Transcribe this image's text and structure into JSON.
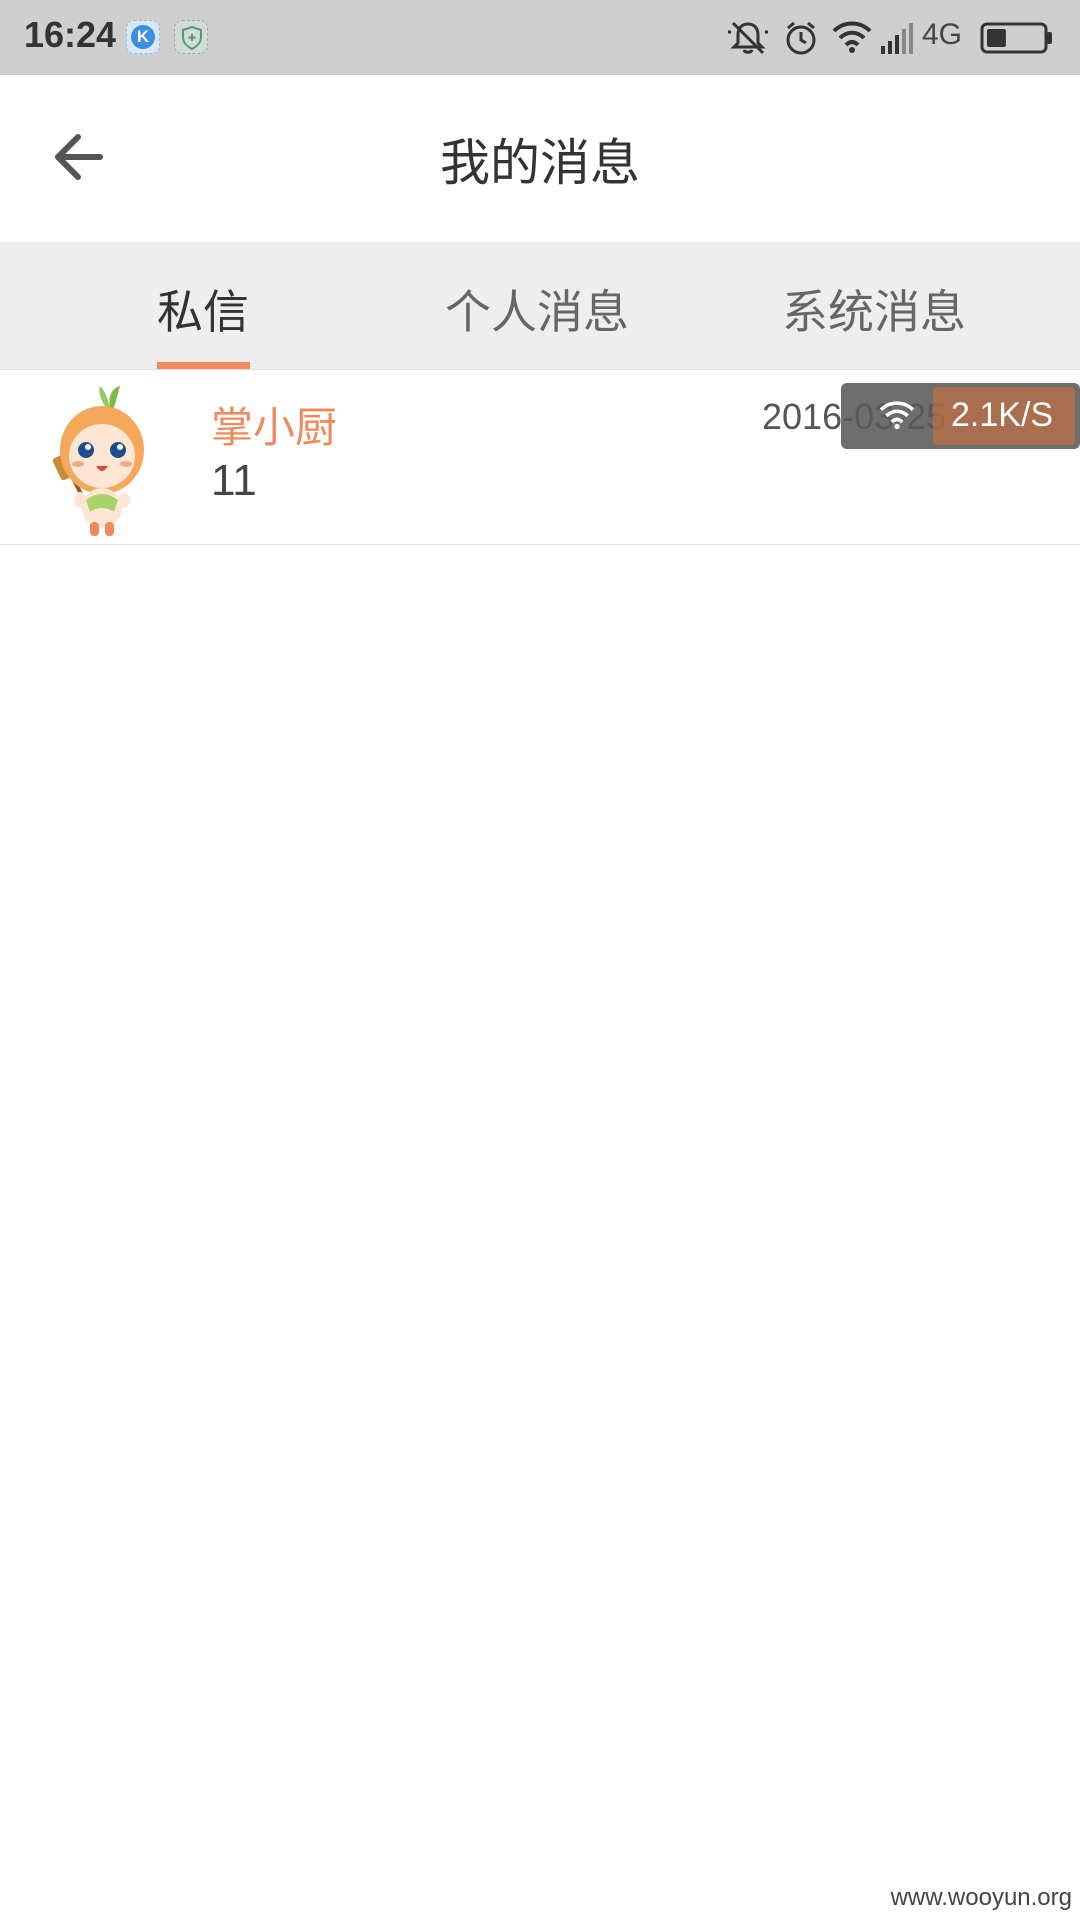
{
  "status_bar": {
    "time": "16:24",
    "app_badge_letter": "K",
    "network_type": "4G",
    "icons": [
      "k-app-icon",
      "shield-icon",
      "mute-icon",
      "alarm-icon",
      "wifi-icon",
      "signal-icon",
      "battery-icon"
    ],
    "battery_level": 0.35
  },
  "header": {
    "title": "我的消息",
    "back_icon": "arrow-left-icon"
  },
  "tabs": [
    {
      "label": "私信",
      "active": true
    },
    {
      "label": "个人消息",
      "active": false
    },
    {
      "label": "系统消息",
      "active": false
    }
  ],
  "messages": [
    {
      "sender": "掌小厨",
      "preview": "11",
      "date": "2016-03-25",
      "avatar_icon": "onion-mascot-icon"
    }
  ],
  "speed_overlay": {
    "speed": "2.1K/S",
    "icon": "wifi-icon"
  },
  "watermark": "www.wooyun.org",
  "colors": {
    "accent": "#f08a5d",
    "status_bar_bg": "#cfcfcf",
    "tab_bar_bg": "#eeeeee"
  }
}
